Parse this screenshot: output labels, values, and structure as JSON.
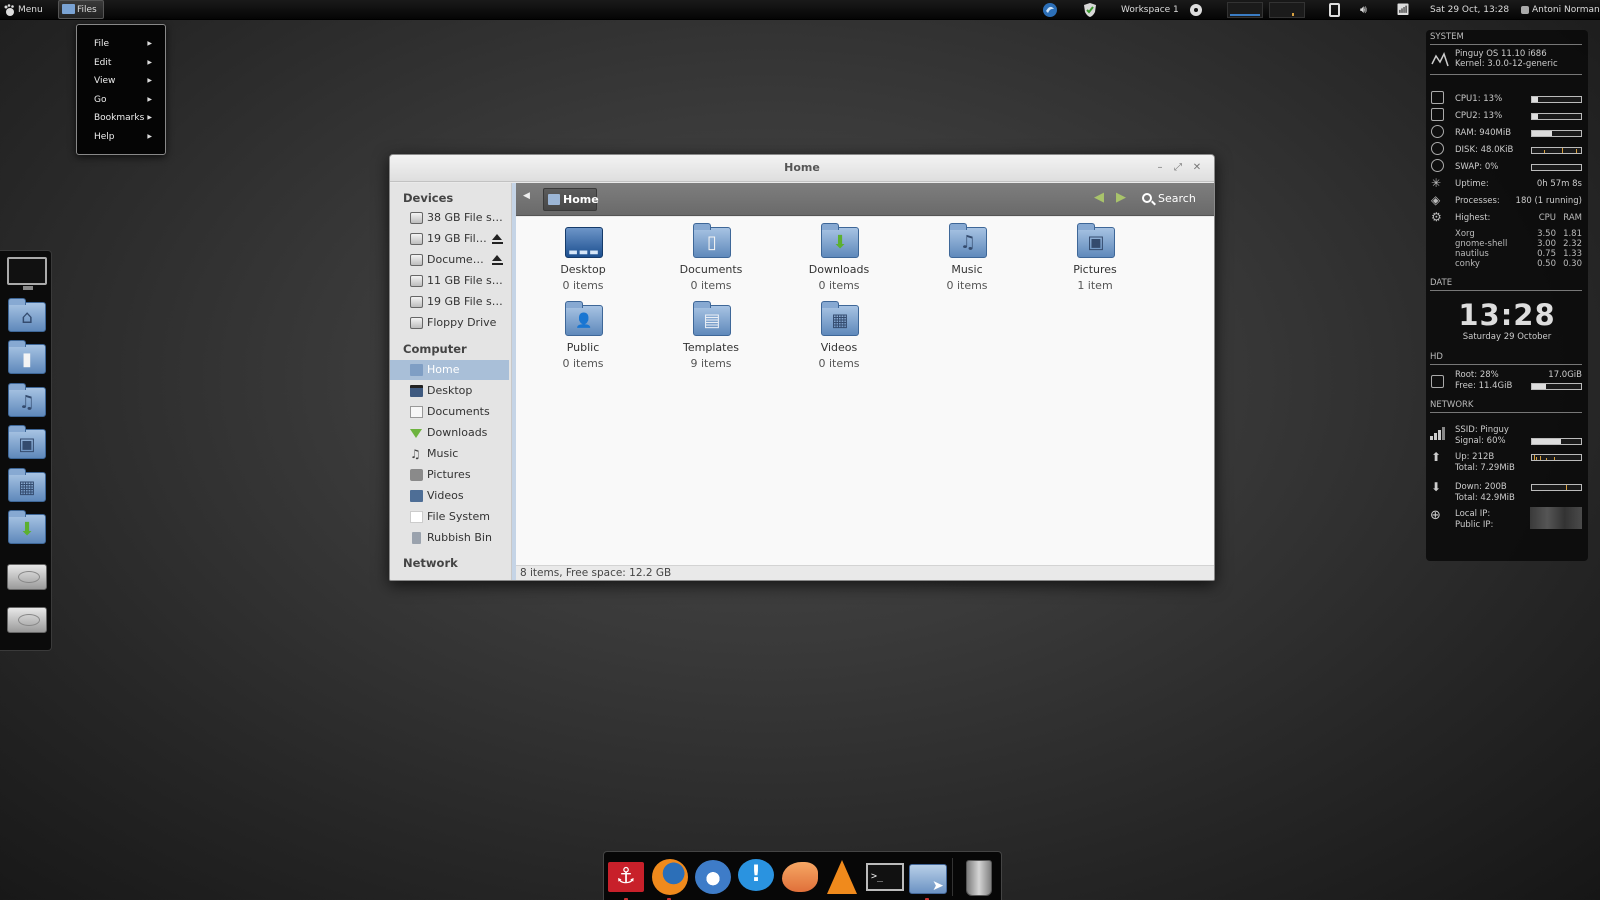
{
  "top_panel": {
    "menu_label": "Menu",
    "files_label": "Files",
    "workspace": "Workspace 1",
    "datetime": "Sat 29 Oct, 13:28",
    "user": "Antoni Norman"
  },
  "app_menu": {
    "items": [
      {
        "label": "File"
      },
      {
        "label": "Edit"
      },
      {
        "label": "View"
      },
      {
        "label": "Go"
      },
      {
        "label": "Bookmarks"
      },
      {
        "label": "Help"
      }
    ]
  },
  "left_dock": {
    "items": [
      "monitor-icon",
      "home-folder-icon",
      "documents-folder-icon",
      "music-folder-icon",
      "pictures-folder-icon",
      "videos-folder-icon",
      "downloads-folder-icon",
      "drive-icon",
      "drive-icon"
    ]
  },
  "window": {
    "title": "Home",
    "sidebar": {
      "devices_heading": "Devices",
      "devices": [
        {
          "label": "38 GB File syst...",
          "eject": false
        },
        {
          "label": "19 GB File...",
          "eject": true
        },
        {
          "label": "Documents",
          "eject": true
        },
        {
          "label": "11 GB File syst...",
          "eject": false
        },
        {
          "label": "19 GB File syst...",
          "eject": false
        },
        {
          "label": "Floppy Drive",
          "eject": false
        }
      ],
      "computer_heading": "Computer",
      "computer": [
        {
          "label": "Home",
          "icon": "home-icon",
          "selected": true
        },
        {
          "label": "Desktop",
          "icon": "desktop-icon"
        },
        {
          "label": "Documents",
          "icon": "document-icon"
        },
        {
          "label": "Downloads",
          "icon": "downloads-icon"
        },
        {
          "label": "Music",
          "icon": "music-icon"
        },
        {
          "label": "Pictures",
          "icon": "pictures-icon"
        },
        {
          "label": "Videos",
          "icon": "videos-icon"
        },
        {
          "label": "File System",
          "icon": "filesystem-icon"
        },
        {
          "label": "Rubbish Bin",
          "icon": "trash-icon"
        }
      ],
      "network_heading": "Network"
    },
    "toolbar": {
      "breadcrumb": "Home",
      "search_label": "Search"
    },
    "files": [
      {
        "name": "Desktop",
        "count": "0 items",
        "glyph": "▬▬▬"
      },
      {
        "name": "Documents",
        "count": "0 items",
        "glyph": "▯"
      },
      {
        "name": "Downloads",
        "count": "0 items",
        "glyph": "⬇"
      },
      {
        "name": "Music",
        "count": "0 items",
        "glyph": "♫"
      },
      {
        "name": "Pictures",
        "count": "1 item",
        "glyph": "▣"
      },
      {
        "name": "Public",
        "count": "0 items",
        "glyph": "👤"
      },
      {
        "name": "Templates",
        "count": "9 items",
        "glyph": "▤"
      },
      {
        "name": "Videos",
        "count": "0 items",
        "glyph": "▦"
      }
    ],
    "status": "8 items, Free space: 12.2 GB"
  },
  "conky": {
    "system_heading": "SYSTEM",
    "os": "Pinguy OS 11.10 i686",
    "kernel": "Kernel: 3.0.0-12-generic",
    "cpu1": {
      "label": "CPU1: 13%",
      "percent": 13
    },
    "cpu2": {
      "label": "CPU2: 13%",
      "percent": 13
    },
    "ram": {
      "label": "RAM: 940MiB",
      "percent": 40
    },
    "disk": {
      "label": "DISK: 48.0KiB"
    },
    "swap": {
      "label": "SWAP: 0%",
      "percent": 0
    },
    "uptime_label": "Uptime:",
    "uptime_value": "0h 57m 8s",
    "processes_label": "Processes:",
    "processes_value": "180 (1 running)",
    "highest_label": "Highest:",
    "cpu_col": "CPU",
    "ram_col": "RAM",
    "top": [
      {
        "name": "Xorg",
        "cpu": "3.50",
        "ram": "1.81"
      },
      {
        "name": "gnome-shell",
        "cpu": "3.00",
        "ram": "2.32"
      },
      {
        "name": "nautilus",
        "cpu": "0.75",
        "ram": "1.33"
      },
      {
        "name": "conky",
        "cpu": "0.50",
        "ram": "0.30"
      }
    ],
    "date_heading": "DATE",
    "time": "13:28",
    "date": "Saturday 29 October",
    "hd_heading": "HD",
    "root": "Root: 28%",
    "root_size": "17.0GiB",
    "free": "Free: 11.4GiB",
    "root_percent": 28,
    "network_heading": "NETWORK",
    "ssid": "SSID: Pinguy",
    "signal": "Signal: 60%",
    "signal_percent": 60,
    "up": "Up: 212B",
    "up_total": "Total: 7.29MiB",
    "down": "Down: 200B",
    "down_total": "Total: 42.9MiB",
    "local_ip": "Local IP:",
    "public_ip": "Public IP:"
  },
  "bottom_dock": {
    "items": [
      "anchor-icon",
      "firefox-icon",
      "thunderbird-icon",
      "chat-icon",
      "orange-app-icon",
      "vlc-icon",
      "terminal-icon",
      "files-icon",
      "trash-icon"
    ],
    "terminal_prompt": ">_"
  }
}
